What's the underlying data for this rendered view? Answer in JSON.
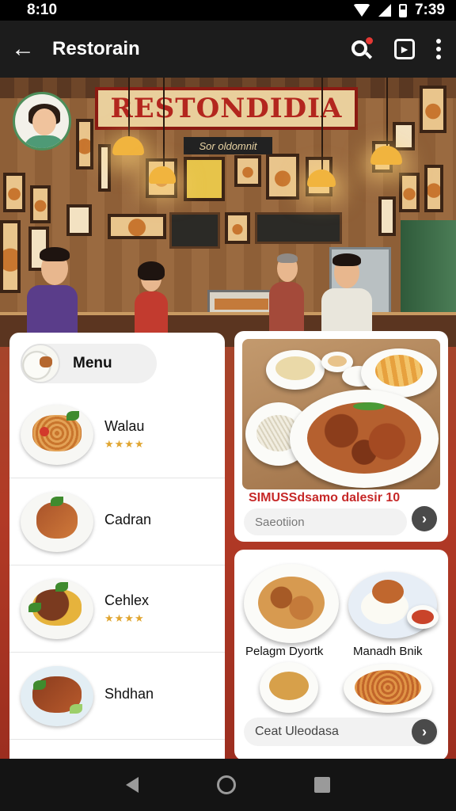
{
  "status_bar": {
    "time_left": "8:10",
    "time_right": "7:39"
  },
  "app_bar": {
    "title": "Restorain",
    "back_label": "←"
  },
  "hero": {
    "sign": "RESTONDIDIA",
    "sub_sign": "Sor oldomnit"
  },
  "menu": {
    "header_label": "Menu",
    "items": [
      {
        "name": "Walau",
        "rating": "★★★★"
      },
      {
        "name": "Cadran",
        "rating": ""
      },
      {
        "name": "Cehlex",
        "rating": "★★★★"
      },
      {
        "name": "Shdhan",
        "rating": ""
      }
    ]
  },
  "card_featured": {
    "title": "SIMUSSdsamo dalesir 10",
    "subtitle": "Saeotiion",
    "go_label": "›"
  },
  "card_combo": {
    "dish_left": "Pelagm Dyortk",
    "dish_right": "Manadh Bnik",
    "bar_label": "Ceat Uleodasa",
    "go_label": "›"
  },
  "colors": {
    "accent": "#c62828",
    "app_bar": "#1c1c1c",
    "background_red": "#b23a26"
  },
  "icons": [
    "back-arrow-icon",
    "search-icon",
    "share-icon",
    "more-vert-icon",
    "nav-back-icon",
    "nav-home-icon",
    "nav-recents-icon"
  ]
}
